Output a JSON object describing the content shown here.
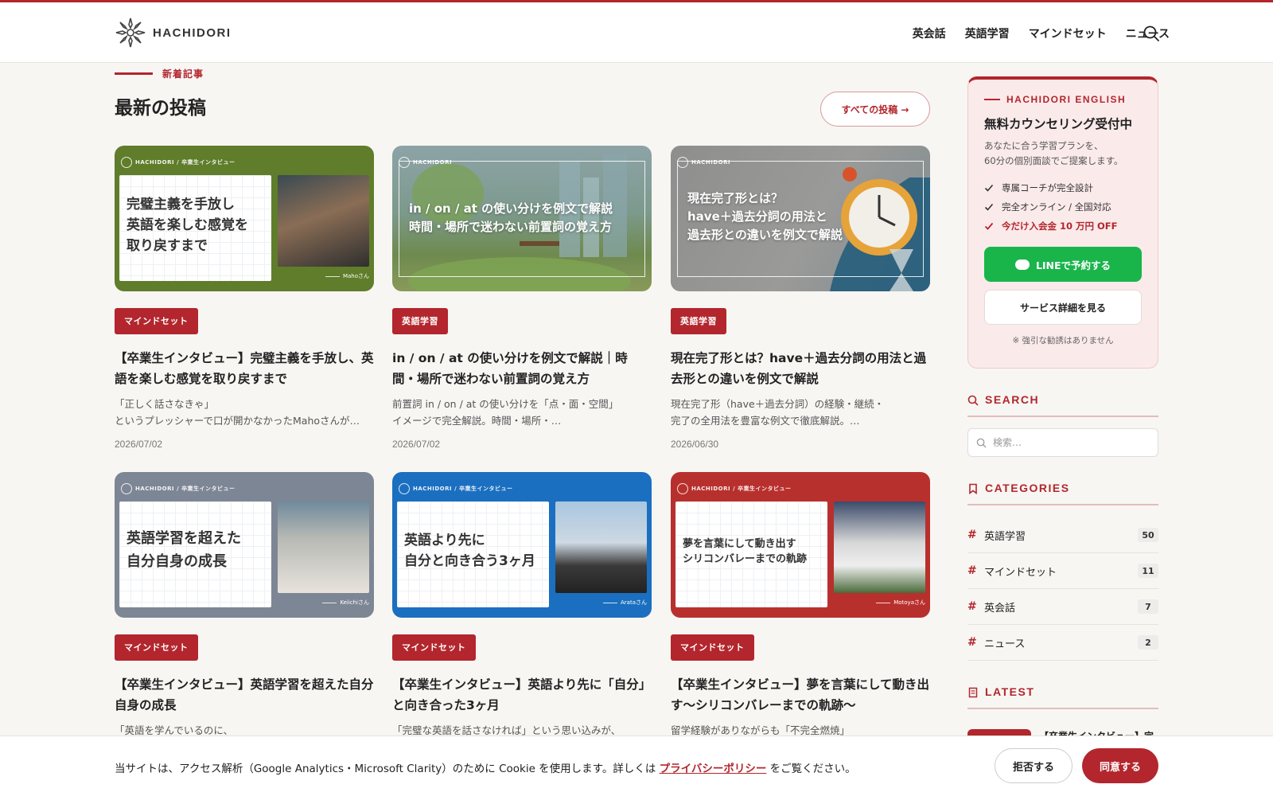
{
  "brand": {
    "name": "HACHIDORI",
    "accent": "#b3262d"
  },
  "nav": {
    "items": [
      "英会話",
      "英語学習",
      "マインドセット",
      "ニュース"
    ],
    "search_icon": "search-icon"
  },
  "section": {
    "eyebrow": "新着記事",
    "title": "最新の投稿",
    "all_posts": "すべての投稿 →"
  },
  "posts": [
    {
      "thumb_brand": "HACHIDORI / 卒業生インタビュー",
      "thumb_text": "完璧主義を手放し\n英語を楽しむ感覚を\n取り戻すまで",
      "thumb_credit": "Mahoさん",
      "category": "マインドセット",
      "title": "【卒業生インタビュー】完璧主義を手放し、英語を楽しむ感覚を取り戻すまで",
      "excerpt": "「正しく話さなきゃ」\nというプレッシャーで口が開かなかったMahoさんが…",
      "date": "2026/07/02"
    },
    {
      "thumb_brand": "HACHIDORI",
      "thumb_text": "in / on / at の使い分けを例文で解説\n時間・場所で迷わない前置詞の覚え方",
      "category": "英語学習",
      "title": "in / on / at の使い分けを例文で解説｜時間・場所で迷わない前置詞の覚え方",
      "excerpt": "前置詞 in / on / at の使い分けを「点・面・空間」\nイメージで完全解説。時間・場所・…",
      "date": "2026/07/02"
    },
    {
      "thumb_brand": "HACHIDORI",
      "thumb_text": "現在完了形とは？\nhave＋過去分詞の用法と\n過去形との違いを例文で解説",
      "category": "英語学習",
      "title": "現在完了形とは？have＋過去分詞の用法と過去形との違いを例文で解説",
      "excerpt": "現在完了形（have＋過去分詞）の経験・継続・\n完了の全用法を豊富な例文で徹底解説。…",
      "date": "2026/06/30"
    },
    {
      "thumb_brand": "HACHIDORI / 卒業生インタビュー",
      "thumb_text": "英語学習を超えた\n自分自身の成長",
      "thumb_credit": "Keiichiさん",
      "category": "マインドセット",
      "title": "【卒業生インタビュー】英語学習を超えた自分自身の成長",
      "excerpt": "「英語を学んでいるのに、"
    },
    {
      "thumb_brand": "HACHIDORI / 卒業生インタビュー",
      "thumb_text": "英語より先に\n自分と向き合う3ヶ月",
      "thumb_credit": "Arataさん",
      "category": "マインドセット",
      "title": "【卒業生インタビュー】英語より先に「自分」と向き合った3ヶ月",
      "excerpt": "「完璧な英語を話さなければ」という思い込みが、"
    },
    {
      "thumb_brand": "HACHIDORI / 卒業生インタビュー",
      "thumb_text": "夢を言葉にして動き出す\nシリコンバレーまでの軌跡",
      "thumb_credit": "Motoyaさん",
      "category": "マインドセット",
      "title": "【卒業生インタビュー】夢を言葉にして動き出す〜シリコンバレーまでの軌跡〜",
      "excerpt": "留学経験がありながらも「不完全燃焼」"
    }
  ],
  "promo": {
    "eyebrow": "HACHIDORI ENGLISH",
    "title": "無料カウンセリング受付中",
    "desc": "あなたに合う学習プランを、\n60分の個別面談でご提案します。",
    "features": [
      "専属コーチが完全設計",
      "完全オンライン / 全国対応",
      "今だけ入会金 10 万円 OFF"
    ],
    "line_button": "LINEで予約する",
    "detail_button": "サービス詳細を見る",
    "note": "※ 強引な勧誘はありません"
  },
  "sidebar": {
    "search_heading": "SEARCH",
    "search_placeholder": "検索…",
    "categories_heading": "CATEGORIES",
    "categories": [
      {
        "name": "英語学習",
        "count": "50"
      },
      {
        "name": "マインドセット",
        "count": "11"
      },
      {
        "name": "英会話",
        "count": "7"
      },
      {
        "name": "ニュース",
        "count": "2"
      }
    ],
    "latest_heading": "LATEST",
    "latest_first": "【卒業生インタビュー】完"
  },
  "cookie": {
    "text_before": "当サイトは、アクセス解析（Google Analytics・Microsoft Clarity）のために Cookie を使用します。詳しくは",
    "link": "プライバシーポリシー",
    "text_after": "をご覧ください。",
    "reject": "拒否する",
    "accept": "同意する"
  }
}
